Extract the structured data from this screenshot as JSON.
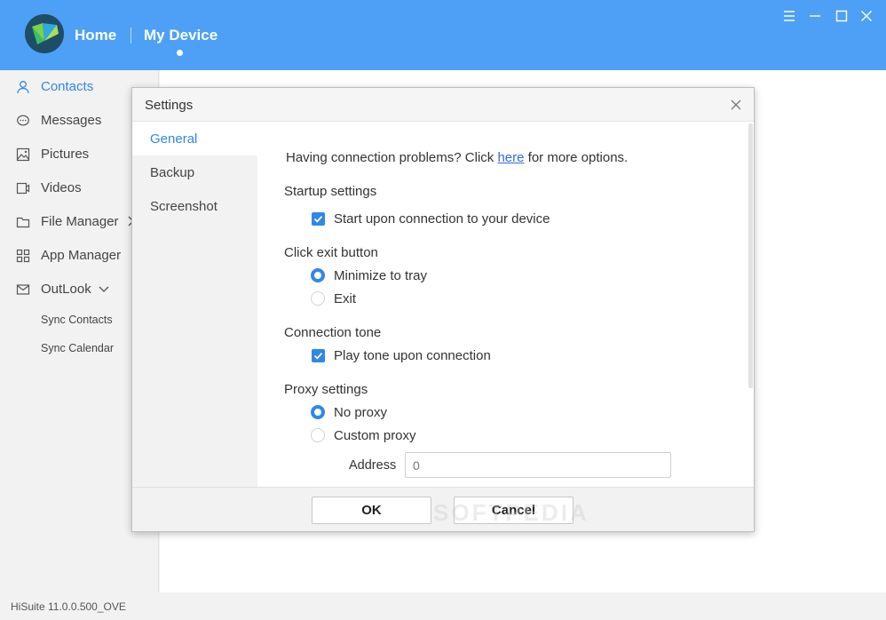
{
  "header": {
    "home_label": "Home",
    "device_label": "My Device",
    "accent": "#4da0f5"
  },
  "sidebar": {
    "items": [
      {
        "label": "Contacts",
        "icon": "person-icon",
        "active": true
      },
      {
        "label": "Messages",
        "icon": "chat-bubble-icon"
      },
      {
        "label": "Pictures",
        "icon": "picture-icon"
      },
      {
        "label": "Videos",
        "icon": "video-icon"
      },
      {
        "label": "File Manager",
        "icon": "folder-icon"
      },
      {
        "label": "App Manager",
        "icon": "grid-icon"
      },
      {
        "label": "OutLook",
        "icon": "mail-icon"
      }
    ],
    "sub_items": [
      {
        "label": "Sync Contacts"
      },
      {
        "label": "Sync Calendar"
      }
    ]
  },
  "footer": {
    "version": "HiSuite 11.0.0.500_OVE"
  },
  "dialog": {
    "title": "Settings",
    "tabs": [
      {
        "label": "General",
        "active": true
      },
      {
        "label": "Backup"
      },
      {
        "label": "Screenshot"
      }
    ],
    "conn_problem_prefix": "Having connection problems? Click",
    "conn_problem_link": "here",
    "conn_problem_suffix": "for more options.",
    "startup": {
      "heading": "Startup settings",
      "option_label": "Start upon connection to your device",
      "checked": true
    },
    "exit": {
      "heading": "Click exit button",
      "options": [
        {
          "label": "Minimize to tray",
          "selected": true
        },
        {
          "label": "Exit",
          "selected": false
        }
      ]
    },
    "tone": {
      "heading": "Connection tone",
      "option_label": "Play tone upon connection",
      "checked": true
    },
    "proxy": {
      "heading": "Proxy settings",
      "options": [
        {
          "label": "No proxy",
          "selected": true
        },
        {
          "label": "Custom proxy",
          "selected": false
        }
      ],
      "address_label": "Address",
      "address_placeholder": "0"
    },
    "ok_label": "OK",
    "cancel_label": "Cancel"
  },
  "watermark": "SOFTPEDIA"
}
